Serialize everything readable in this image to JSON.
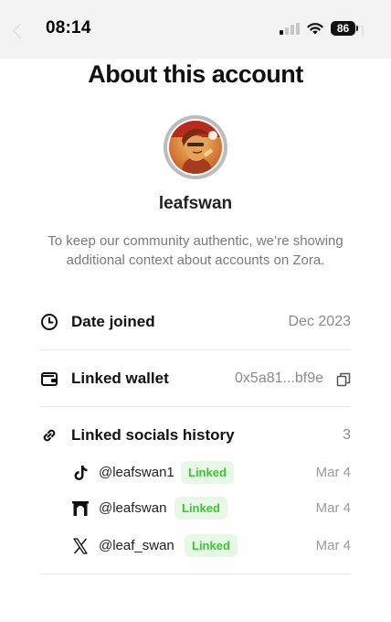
{
  "status_bar": {
    "time": "08:14",
    "battery": "86"
  },
  "page": {
    "title": "About this account"
  },
  "profile": {
    "username": "leafswan",
    "description": "To keep our community authentic, we’re showing additional context about accounts on Zora."
  },
  "date_joined": {
    "icon": "clock-icon",
    "label": "Date joined",
    "value": "Dec 2023"
  },
  "linked_wallet": {
    "icon": "wallet-icon",
    "label": "Linked wallet",
    "value": "0x5a81...bf9e",
    "copy_icon": "copy-icon"
  },
  "linked_socials": {
    "icon": "link-icon",
    "label": "Linked socials history",
    "count": "3",
    "items": [
      {
        "platform_icon": "tiktok-icon",
        "handle": "@leafswan1",
        "status": "Linked",
        "date": "Mar 4"
      },
      {
        "platform_icon": "farcaster-icon",
        "handle": "@leafswan",
        "status": "Linked",
        "date": "Mar 4"
      },
      {
        "platform_icon": "x-icon",
        "handle": "@leaf_swan",
        "status": "Linked",
        "date": "Mar 4"
      }
    ]
  },
  "colors": {
    "linked_badge_bg": "#e8f8e6",
    "linked_badge_text": "#3fc23a",
    "muted_text": "#8a8a8a"
  }
}
